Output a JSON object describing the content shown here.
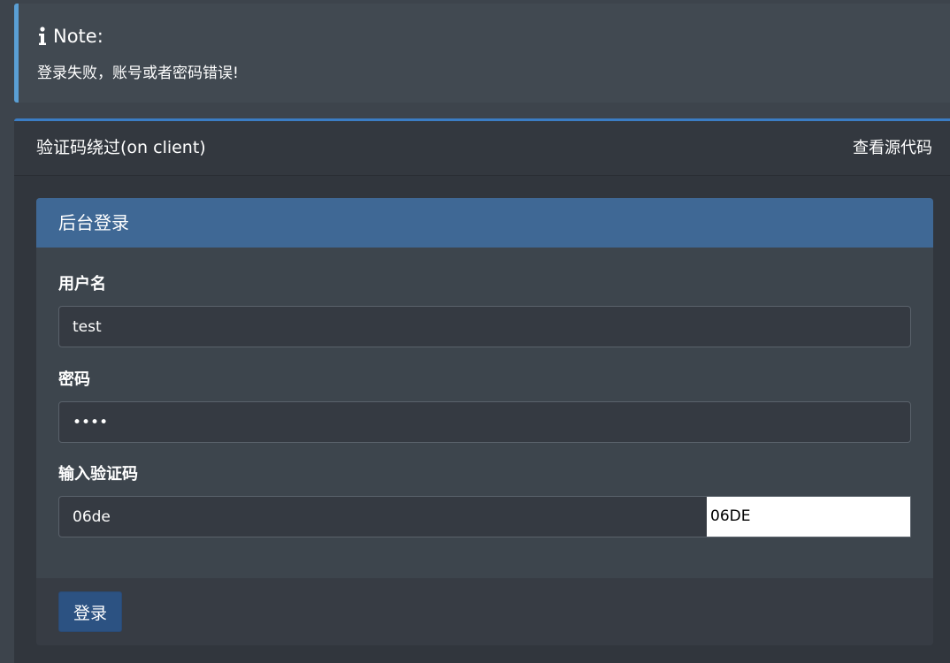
{
  "note": {
    "title": "Note:",
    "message": "登录失败，账号或者密码错误!"
  },
  "panel": {
    "title": "验证码绕过(on client)",
    "view_source_link": "查看源代码"
  },
  "login_box": {
    "title": "后台登录",
    "username_label": "用户名",
    "username_value": "test",
    "password_label": "密码",
    "password_value": "test",
    "captcha_label": "输入验证码",
    "captcha_value": "06de",
    "captcha_code": "06DE",
    "submit_label": "登录"
  },
  "colors": {
    "page_bg": "#3d444c",
    "note_accent": "#5a9fd4",
    "panel_accent": "#3b7dc4",
    "box_header": "#3f6895",
    "button": "#2c5282"
  },
  "icons": {
    "note_icon": "info-icon"
  }
}
